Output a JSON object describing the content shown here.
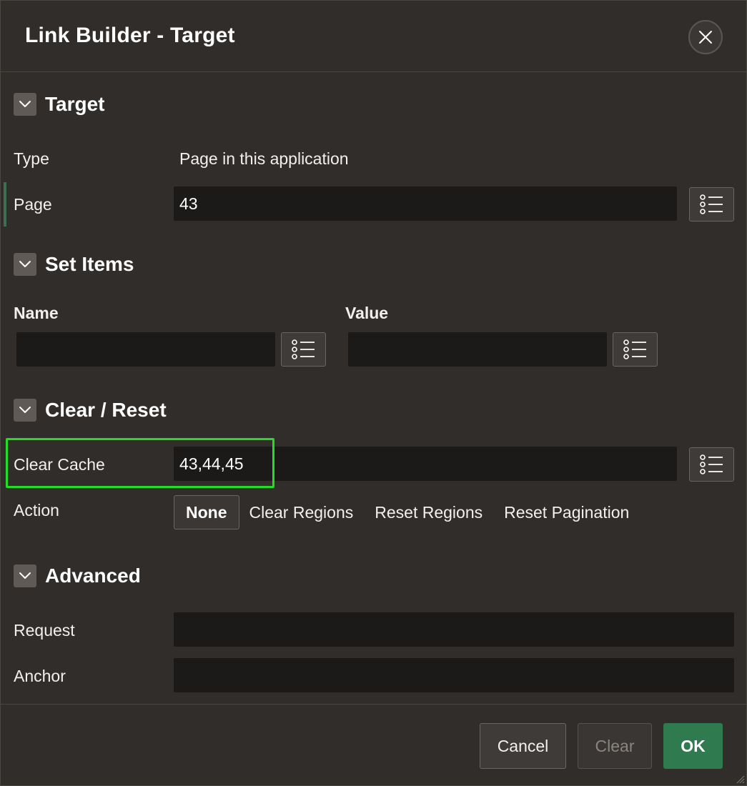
{
  "dialog": {
    "title": "Link Builder - Target",
    "close_label": "Close"
  },
  "target": {
    "heading": "Target",
    "type_label": "Type",
    "type_value": "Page in this application",
    "page_label": "Page",
    "page_value": "43"
  },
  "set_items": {
    "heading": "Set Items",
    "name_header": "Name",
    "value_header": "Value",
    "name_value": "",
    "value_value": ""
  },
  "clear_reset": {
    "heading": "Clear / Reset",
    "clear_cache_label": "Clear Cache",
    "clear_cache_value": "43,44,45",
    "action_label": "Action",
    "actions": [
      "None",
      "Clear Regions",
      "Reset Regions",
      "Reset Pagination"
    ],
    "selected_action": "None"
  },
  "advanced": {
    "heading": "Advanced",
    "request_label": "Request",
    "request_value": "",
    "anchor_label": "Anchor",
    "anchor_value": ""
  },
  "footer": {
    "cancel_label": "Cancel",
    "clear_label": "Clear",
    "ok_label": "OK"
  },
  "colors": {
    "background": "#312d2a",
    "field_background": "#1c1a19",
    "ok_button": "#2f7a4e",
    "highlight": "#22dd22"
  },
  "icons": {
    "close": "close-icon",
    "collapse": "chevron-down-icon",
    "list_of_values": "list-icon"
  }
}
